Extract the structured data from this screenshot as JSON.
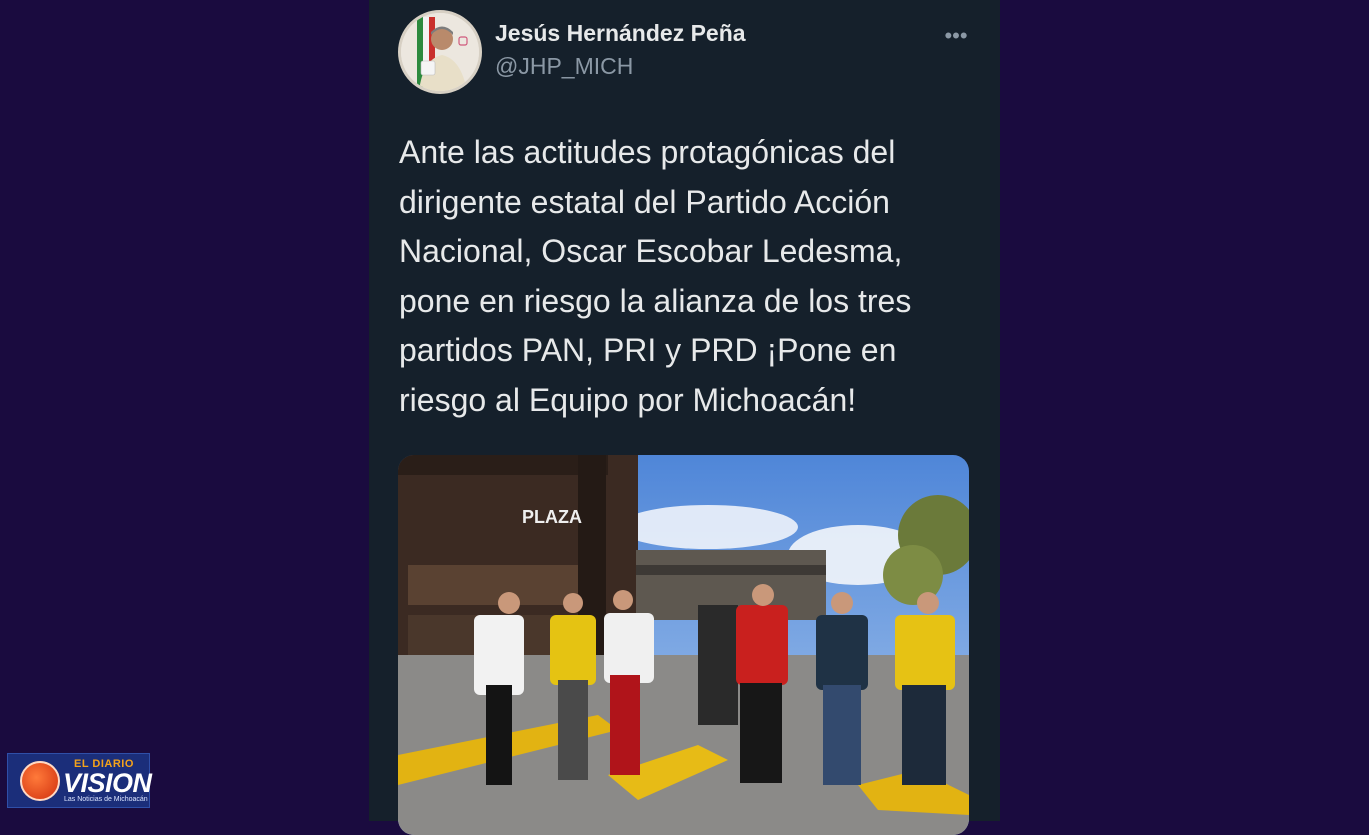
{
  "tweet": {
    "author_name": "Jesús Hernández Peña",
    "author_handle": "@JHP_MICH",
    "more_icon": "more-horizontal-icon",
    "more_glyph": "•••",
    "text": "Ante las actitudes protagónicas del dirigente estatal del Partido Acción Nacional, Oscar Escobar Ledesma, pone en riesgo la alianza de los tres partidos PAN, PRI y PRD ¡Pone en riesgo al Equipo por Michoacán!",
    "media": {
      "sign_text": "PLAZA"
    }
  },
  "watermark": {
    "top": "EL DIARIO",
    "main": "VISION",
    "sub": "Las Noticias de Michoacán"
  },
  "colors": {
    "page_background": "#1a0b3f",
    "card_background": "#15202b",
    "text_primary": "#e7e9ea",
    "text_secondary": "#8b98a5",
    "logo_background": "#1b2e7a",
    "logo_accent": "#f4a31b"
  }
}
